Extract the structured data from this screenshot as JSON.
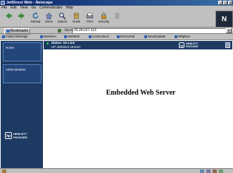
{
  "window": {
    "title": "JetDirect Web - Netscape"
  },
  "menu": [
    "File",
    "Edit",
    "View",
    "Go",
    "Communicator",
    "Help"
  ],
  "toolbar": {
    "buttons": [
      {
        "label": "",
        "icon": "back-arrow-icon"
      },
      {
        "label": "",
        "icon": "forward-arrow-icon"
      },
      {
        "label": "Reload",
        "icon": "reload-icon"
      },
      {
        "label": "Home",
        "icon": "home-icon"
      },
      {
        "label": "Search",
        "icon": "search-icon"
      },
      {
        "label": "Guide",
        "icon": "guide-icon"
      },
      {
        "label": "Print",
        "icon": "print-icon"
      },
      {
        "label": "Security",
        "icon": "security-icon"
      },
      {
        "label": "",
        "icon": "stop-icon"
      }
    ],
    "logo": "N"
  },
  "location": {
    "bookmarks_label": "Bookmarks",
    "goto_label": "Go to:",
    "url": "15.24.227.113"
  },
  "personal_toolbar": [
    "Instant Message",
    "Members",
    "WebMail",
    "Connections",
    "BizJournal",
    "SmartUpdate",
    "Mktplace"
  ],
  "page": {
    "nav": [
      {
        "label": "Home"
      },
      {
        "label": "Administration"
      }
    ],
    "status": "Status: On Line",
    "model": "HP JetDirect J3113A",
    "hp_brand_line1": "HEWLETT",
    "hp_brand_line2": "PACKARD",
    "hp_logo": "hp",
    "title": "Embedded Web Server"
  },
  "colors": {
    "title_bar": "#0a246a",
    "nav_background": "#1d3a63",
    "status_online": "#30c030"
  }
}
